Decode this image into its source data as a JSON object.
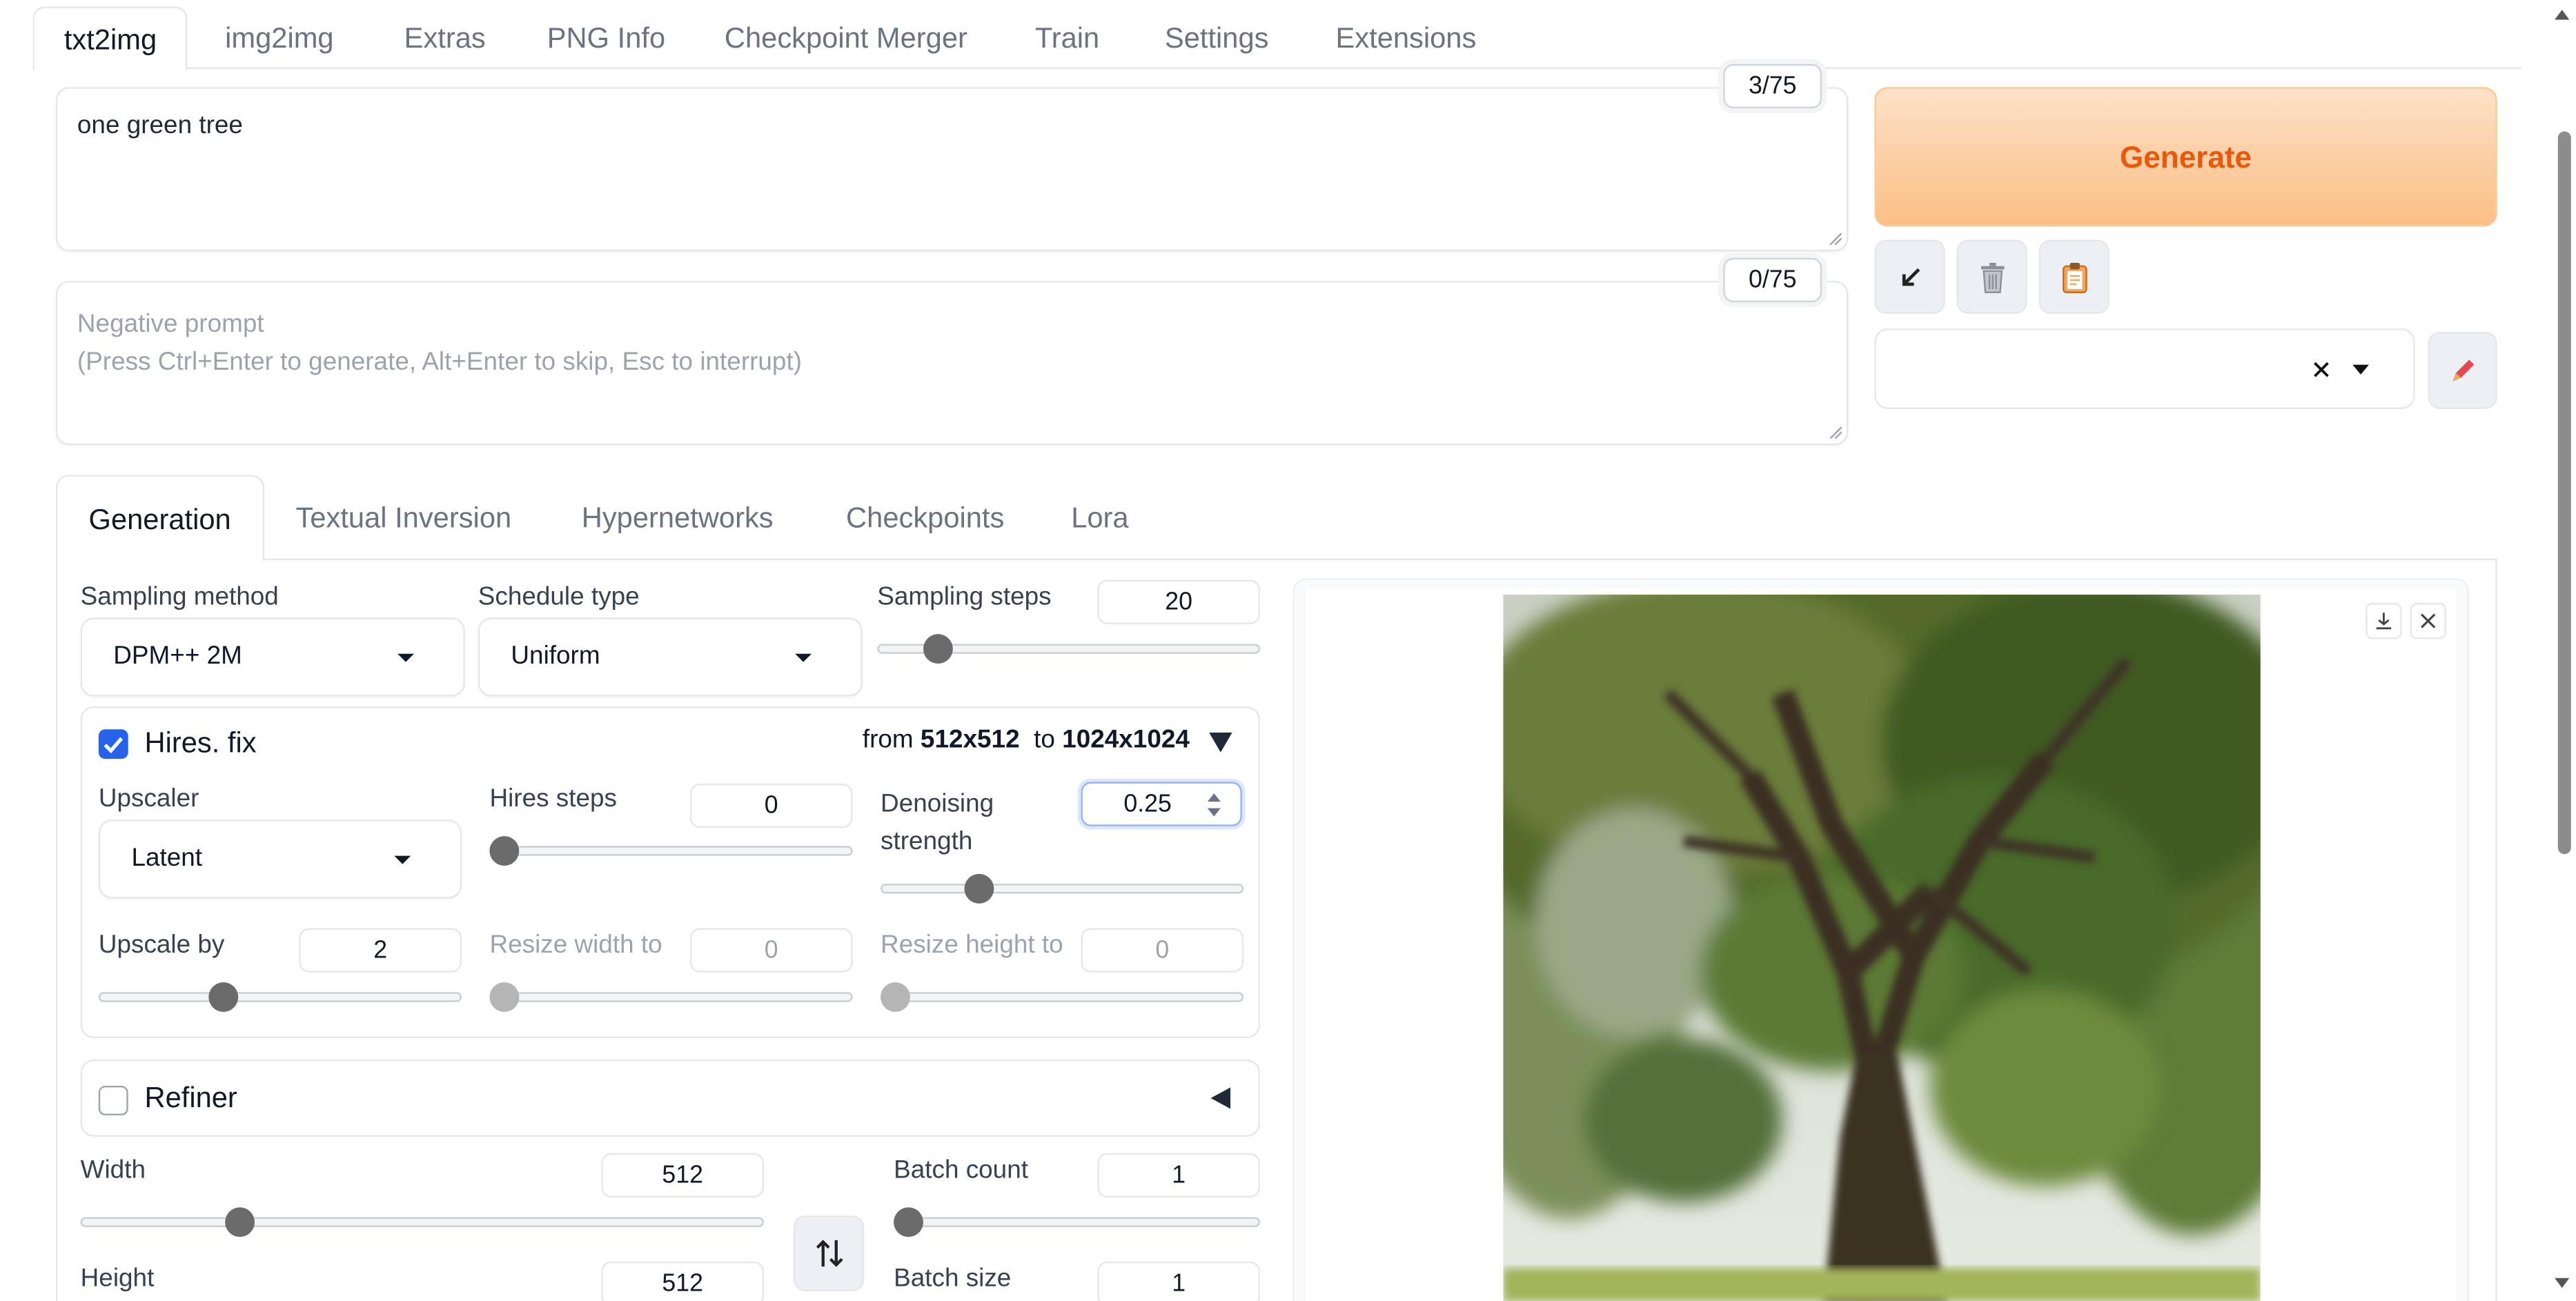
{
  "top_tabs": [
    {
      "label": "txt2img",
      "active": true
    },
    {
      "label": "img2img"
    },
    {
      "label": "Extras"
    },
    {
      "label": "PNG Info"
    },
    {
      "label": "Checkpoint Merger"
    },
    {
      "label": "Train"
    },
    {
      "label": "Settings"
    },
    {
      "label": "Extensions"
    }
  ],
  "prompt": {
    "value": "one green tree",
    "token_count": "3/75"
  },
  "negative_prompt": {
    "placeholder_line1": "Negative prompt",
    "placeholder_line2": "(Press Ctrl+Enter to generate, Alt+Enter to skip, Esc to interrupt)",
    "token_count": "0/75"
  },
  "generate_label": "Generate",
  "tool_icons": [
    "arrow-down-left-icon",
    "trash-icon",
    "clipboard-icon"
  ],
  "styles": {
    "value": "",
    "clear_icon": "close-icon",
    "edit_icon": "pencil-icon"
  },
  "sub_tabs": [
    {
      "label": "Generation",
      "active": true
    },
    {
      "label": "Textual Inversion"
    },
    {
      "label": "Hypernetworks"
    },
    {
      "label": "Checkpoints"
    },
    {
      "label": "Lora"
    }
  ],
  "sampling": {
    "method_label": "Sampling method",
    "method_value": "DPM++ 2M",
    "schedule_label": "Schedule type",
    "schedule_value": "Uniform",
    "steps_label": "Sampling steps",
    "steps_value": "20",
    "steps_fraction": 0.13
  },
  "hires": {
    "label": "Hires. fix",
    "checked": true,
    "from_word": "from",
    "from_size": "512x512",
    "to_word": "to",
    "to_size": "1024x1024",
    "upscaler_label": "Upscaler",
    "upscaler_value": "Latent",
    "steps_label": "Hires steps",
    "steps_value": "0",
    "steps_fraction": 0.0,
    "denoise_label_1": "Denoising",
    "denoise_label_2": "strength",
    "denoise_value": "0.25",
    "denoise_fraction": 0.25,
    "upscale_label": "Upscale by",
    "upscale_value": "2",
    "upscale_fraction": 0.33,
    "resize_w_label": "Resize width to",
    "resize_w_value": "0",
    "resize_h_label": "Resize height to",
    "resize_h_value": "0"
  },
  "refiner": {
    "label": "Refiner",
    "checked": false
  },
  "size": {
    "width_label": "Width",
    "width_value": "512",
    "width_fraction": 0.22,
    "height_label": "Height",
    "height_value": "512"
  },
  "batch": {
    "count_label": "Batch count",
    "count_value": "1",
    "count_fraction": 0.0,
    "size_label": "Batch size",
    "size_value": "1"
  },
  "output": {
    "download_icon": "download-icon",
    "close_icon": "close-icon"
  },
  "colors": {
    "accent": "#2563eb",
    "generate_text": "#ea580c",
    "generate_bg": "#fbbf85"
  }
}
